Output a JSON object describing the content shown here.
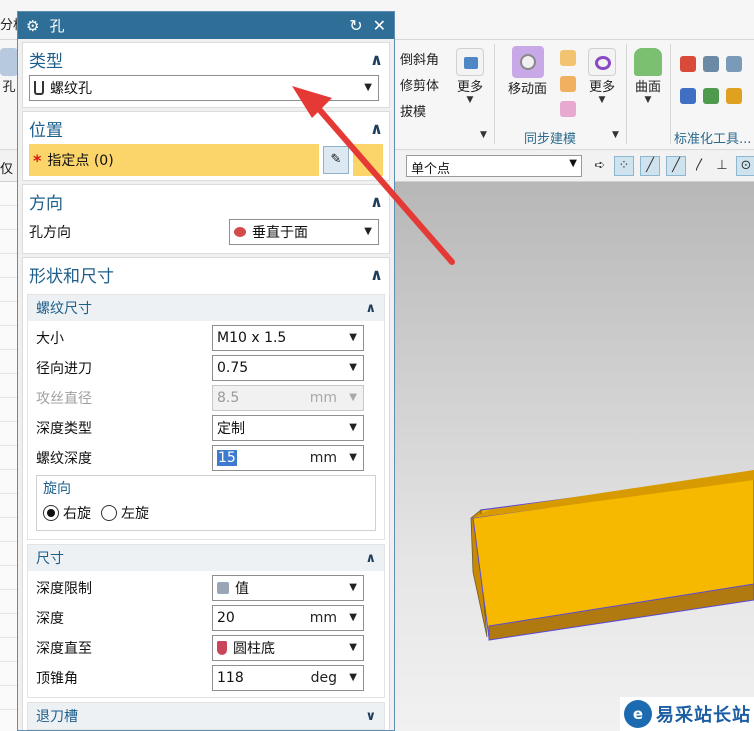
{
  "ribbon": {
    "left_edge_tab": "分析",
    "hole_button_label": "孔",
    "chamfer_label": "倒斜角",
    "trim_label": "修剪体",
    "draft_label": "拔模",
    "more_label_1": "更多",
    "move_face_label": "移动面",
    "more_label_2": "更多",
    "surface_label": "曲面",
    "group_sync": "同步建模",
    "group_standard": "标准化工具..."
  },
  "selection_bar": {
    "left_label": "仅",
    "point_filter": "单个点"
  },
  "dialog": {
    "title": "孔",
    "type": {
      "header": "类型",
      "value": "螺纹孔"
    },
    "position": {
      "header": "位置",
      "specify_point": "指定点 (0)"
    },
    "direction": {
      "header": "方向",
      "label": "孔方向",
      "value": "垂直于面"
    },
    "shape": {
      "header": "形状和尺寸",
      "thread": {
        "header": "螺纹尺寸",
        "size_label": "大小",
        "size_value": "M10 x 1.5",
        "radial_label": "径向进刀",
        "radial_value": "0.75",
        "tap_label": "攻丝直径",
        "tap_value": "8.5",
        "tap_unit": "mm",
        "depth_type_label": "深度类型",
        "depth_type_value": "定制",
        "thread_depth_label": "螺纹深度",
        "thread_depth_value": "15",
        "thread_depth_unit": "mm",
        "rotation": {
          "header": "旋向",
          "right": "右旋",
          "left": "左旋",
          "selected": "right"
        }
      },
      "dimensions": {
        "header": "尺寸",
        "depth_limit_label": "深度限制",
        "depth_limit_value": "值",
        "depth_label": "深度",
        "depth_value": "20",
        "depth_unit": "mm",
        "depth_to_label": "深度直至",
        "depth_to_value": "圆柱底",
        "cone_angle_label": "顶锥角",
        "cone_angle_value": "118",
        "cone_angle_unit": "deg"
      },
      "relief": {
        "header": "退刀槽"
      }
    }
  },
  "watermark": {
    "text": "易采站长站"
  },
  "colors": {
    "title_bar": "#2f6e96",
    "section_header_text": "#1d5f8b",
    "point_highlight": "#fbd56a",
    "block_face": "#f5b400",
    "arrow": "#e53935"
  }
}
